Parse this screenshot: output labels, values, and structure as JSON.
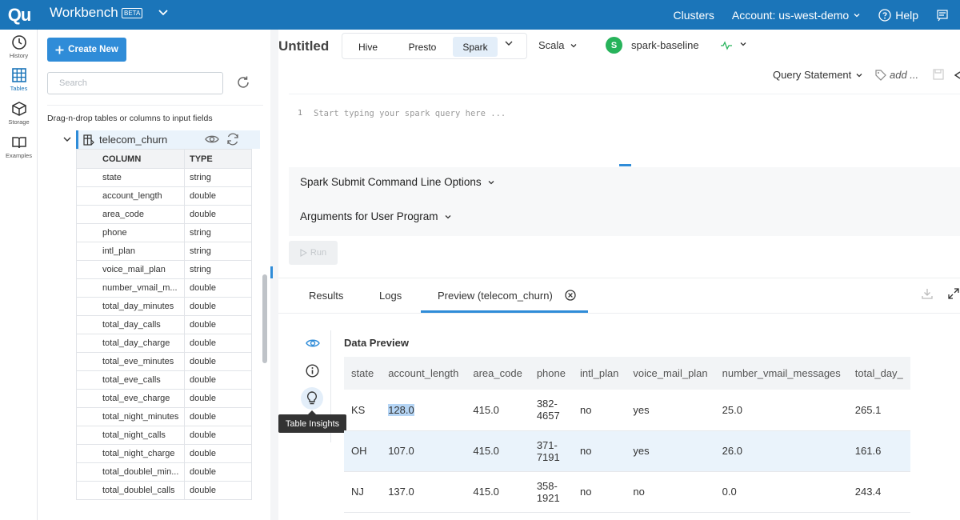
{
  "topbar": {
    "logo": "Qu",
    "app_name": "Workbench",
    "beta": "BETA",
    "clusters": "Clusters",
    "account": "Account: us-west-demo",
    "help": "Help"
  },
  "rail": [
    {
      "label": "History",
      "icon": "history-icon"
    },
    {
      "label": "Tables",
      "icon": "tables-icon"
    },
    {
      "label": "Storage",
      "icon": "storage-icon"
    },
    {
      "label": "Examples",
      "icon": "examples-icon"
    }
  ],
  "panel": {
    "create_label": "Create New",
    "search_placeholder": "Search",
    "dnd_hint": "Drag-n-drop tables or columns to input fields",
    "table_name": "telecom_churn",
    "column_header": "COLUMN",
    "type_header": "TYPE",
    "columns": [
      {
        "name": "state",
        "type": "string"
      },
      {
        "name": "account_length",
        "type": "double"
      },
      {
        "name": "area_code",
        "type": "double"
      },
      {
        "name": "phone",
        "type": "string"
      },
      {
        "name": "intl_plan",
        "type": "string"
      },
      {
        "name": "voice_mail_plan",
        "type": "string"
      },
      {
        "name": "number_vmail_m...",
        "type": "double"
      },
      {
        "name": "total_day_minutes",
        "type": "double"
      },
      {
        "name": "total_day_calls",
        "type": "double"
      },
      {
        "name": "total_day_charge",
        "type": "double"
      },
      {
        "name": "total_eve_minutes",
        "type": "double"
      },
      {
        "name": "total_eve_calls",
        "type": "double"
      },
      {
        "name": "total_eve_charge",
        "type": "double"
      },
      {
        "name": "total_night_minutes",
        "type": "double"
      },
      {
        "name": "total_night_calls",
        "type": "double"
      },
      {
        "name": "total_night_charge",
        "type": "double"
      },
      {
        "name": "total_doublel_min...",
        "type": "double"
      },
      {
        "name": "total_doublel_calls",
        "type": "double"
      }
    ]
  },
  "editor": {
    "title": "Untitled",
    "engines": [
      "Hive",
      "Presto",
      "Spark"
    ],
    "active_engine": "Spark",
    "language": "Scala",
    "cluster_initial": "S",
    "cluster_name": "spark-baseline",
    "query_statement": "Query Statement",
    "add_tag": "add ...",
    "line_number": "1",
    "placeholder": "Start typing your spark query here ...",
    "option_1": "Spark Submit Command Line Options",
    "option_2": "Arguments for User Program",
    "run_label": "Run",
    "accent": "#2f8cd8",
    "brand": "#1b75b9"
  },
  "results": {
    "tabs": [
      "Results",
      "Logs",
      "Preview (telecom_churn)"
    ],
    "active_tab": "Preview (telecom_churn)",
    "preview_title": "Data Preview",
    "tooltip": "Table Insights",
    "headers": [
      "state",
      "account_length",
      "area_code",
      "phone",
      "intl_plan",
      "voice_mail_plan",
      "number_vmail_messages",
      "total_day_"
    ],
    "rows": [
      [
        "KS",
        "128.0",
        "415.0",
        "382-4657",
        "no",
        "yes",
        "25.0",
        "265.1"
      ],
      [
        "OH",
        "107.0",
        "415.0",
        "371-7191",
        "no",
        "yes",
        "26.0",
        "161.6"
      ],
      [
        "NJ",
        "137.0",
        "415.0",
        "358-1921",
        "no",
        "no",
        "0.0",
        "243.4"
      ]
    ]
  }
}
